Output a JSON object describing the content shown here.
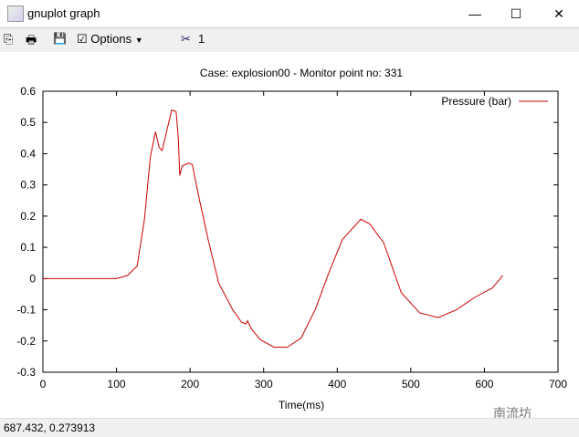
{
  "window": {
    "title": "gnuplot graph",
    "minimize": "—",
    "maximize": "☐",
    "close": "✕"
  },
  "toolbar": {
    "options_label": "Options",
    "options_arrow": "▼",
    "cut_icon": "✂",
    "cut_count": "1",
    "copy_icon": "⎘",
    "print_icon": "🖶",
    "save_icon": "💾"
  },
  "status": {
    "coords": "687.432,  0.273913"
  },
  "watermark": "南流坊",
  "chart_data": {
    "type": "line",
    "title": "Case: explosion00 - Monitor point no: 331",
    "xlabel": "Time(ms)",
    "ylabel": "",
    "xlim": [
      0,
      700
    ],
    "ylim": [
      -0.3,
      0.6
    ],
    "xticks": [
      "0",
      "100",
      "200",
      "300",
      "400",
      "500",
      "600",
      "700"
    ],
    "yticks": [
      "0.6",
      "0.5",
      "0.4",
      "0.3",
      "0.2",
      "0.1",
      "0",
      "-0.1",
      "-0.2",
      "-0.3"
    ],
    "legend": "top-right",
    "color": "#cc0000",
    "series": [
      {
        "name": "Pressure  (bar)",
        "x": [
          0,
          100,
          115,
          128,
          138,
          146,
          153,
          158,
          162,
          169,
          175,
          181,
          184,
          186,
          189,
          198,
          203,
          212,
          225,
          239,
          258,
          270,
          276,
          278,
          283,
          295,
          314,
          332,
          351,
          370,
          388,
          407,
          432,
          444,
          463,
          487,
          512,
          537,
          562,
          587,
          611,
          625
        ],
        "y": [
          0,
          0,
          0.01,
          0.04,
          0.19,
          0.39,
          0.47,
          0.42,
          0.41,
          0.48,
          0.54,
          0.535,
          0.45,
          0.33,
          0.36,
          0.37,
          0.365,
          0.26,
          0.12,
          -0.015,
          -0.1,
          -0.14,
          -0.145,
          -0.135,
          -0.16,
          -0.195,
          -0.22,
          -0.22,
          -0.19,
          -0.1,
          0.015,
          0.125,
          0.19,
          0.175,
          0.115,
          -0.045,
          -0.11,
          -0.125,
          -0.1,
          -0.06,
          -0.03,
          0.01
        ]
      }
    ]
  }
}
